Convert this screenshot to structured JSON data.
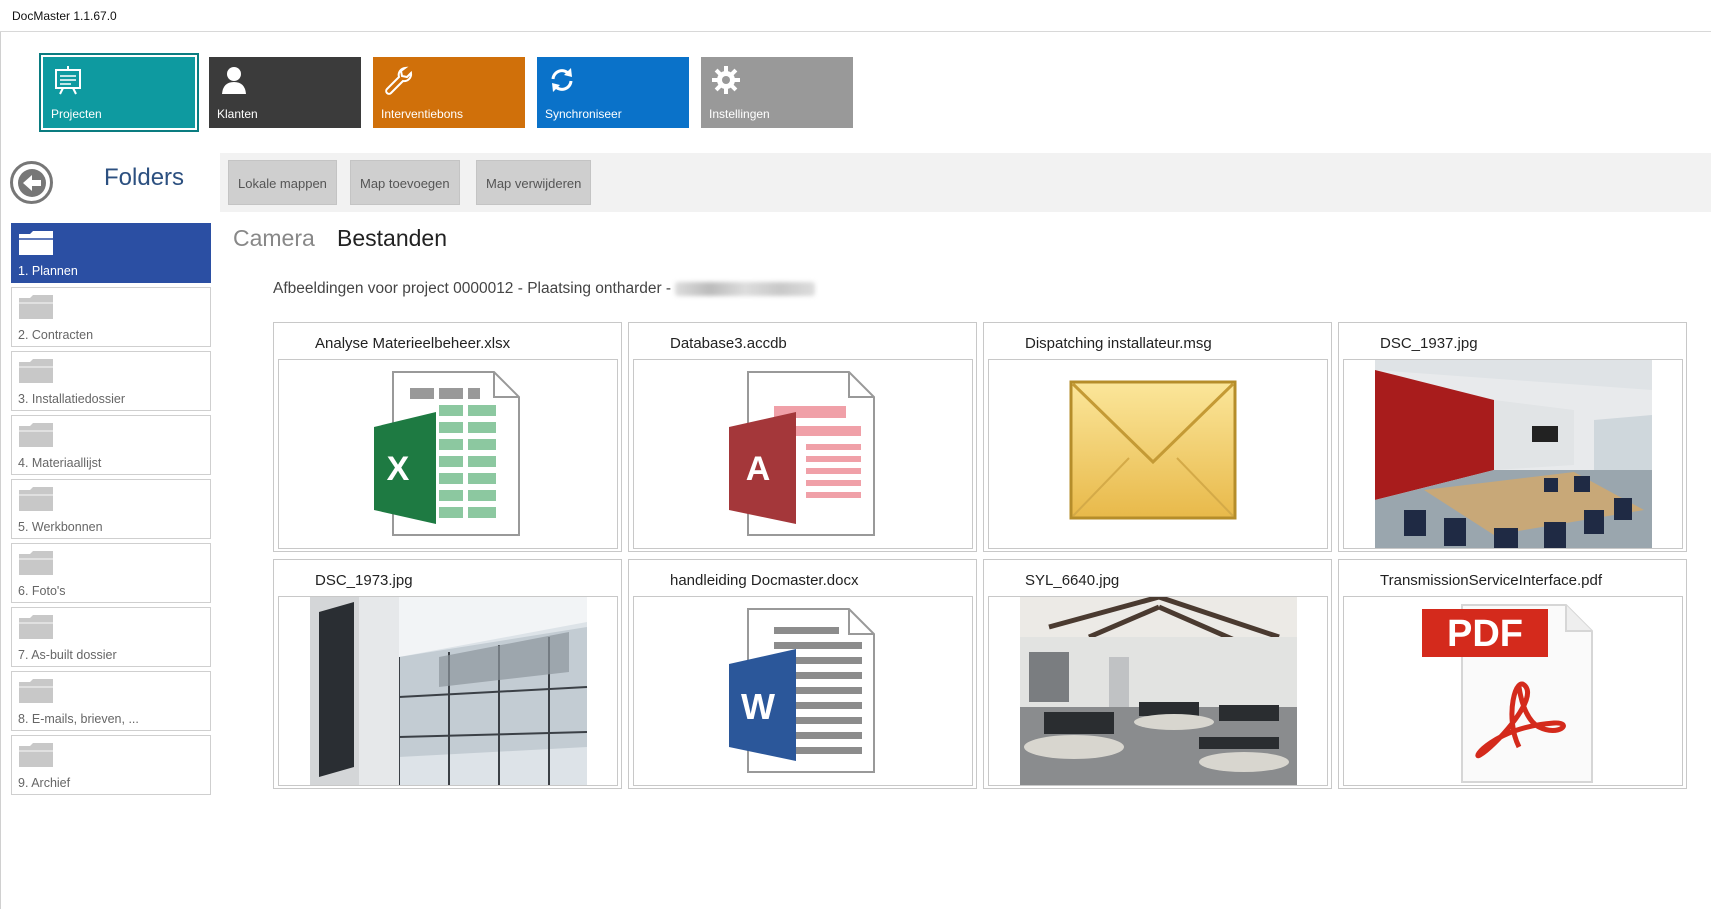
{
  "window": {
    "title": "DocMaster 1.1.67.0"
  },
  "nav": [
    {
      "label": "Projecten",
      "icon": "projector-board-icon",
      "color": "#0e9aa0",
      "active": true
    },
    {
      "label": "Klanten",
      "icon": "user-icon",
      "color": "#3b3b3b"
    },
    {
      "label": "Interventiebons",
      "icon": "wrench-icon",
      "color": "#d0700a"
    },
    {
      "label": "Synchroniseer",
      "icon": "sync-icon",
      "color": "#0a72c9"
    },
    {
      "label": "Instellingen",
      "icon": "gear-icon",
      "color": "#999999"
    }
  ],
  "folders": {
    "title": "Folders",
    "items": [
      {
        "label": "1. Plannen",
        "selected": true
      },
      {
        "label": "2. Contracten"
      },
      {
        "label": "3. Installatiedossier"
      },
      {
        "label": "4. Materiaallijst"
      },
      {
        "label": "5. Werkbonnen"
      },
      {
        "label": "6. Foto's"
      },
      {
        "label": "7. As-built dossier"
      },
      {
        "label": "8. E-mails, brieven, ..."
      },
      {
        "label": "9. Archief"
      }
    ]
  },
  "toolbar": {
    "local_folders": "Lokale mappen",
    "add_folder": "Map toevoegen",
    "remove_folder": "Map verwijderen"
  },
  "tabs": {
    "camera": "Camera",
    "files": "Bestanden"
  },
  "info": {
    "text": "Afbeeldingen voor project 0000012 - Plaatsing ontharder -"
  },
  "files": [
    {
      "name": "Analyse Materieelbeheer.xlsx",
      "type": "excel-icon"
    },
    {
      "name": "Database3.accdb",
      "type": "access-icon"
    },
    {
      "name": "Dispatching installateur.msg",
      "type": "envelope-icon"
    },
    {
      "name": "DSC_1937.jpg",
      "type": "photo-meeting-room"
    },
    {
      "name": "DSC_1973.jpg",
      "type": "photo-atrium"
    },
    {
      "name": "handleiding Docmaster.docx",
      "type": "word-icon"
    },
    {
      "name": "SYL_6640.jpg",
      "type": "photo-office"
    },
    {
      "name": "TransmissionServiceInterface.pdf",
      "type": "pdf-icon"
    }
  ]
}
